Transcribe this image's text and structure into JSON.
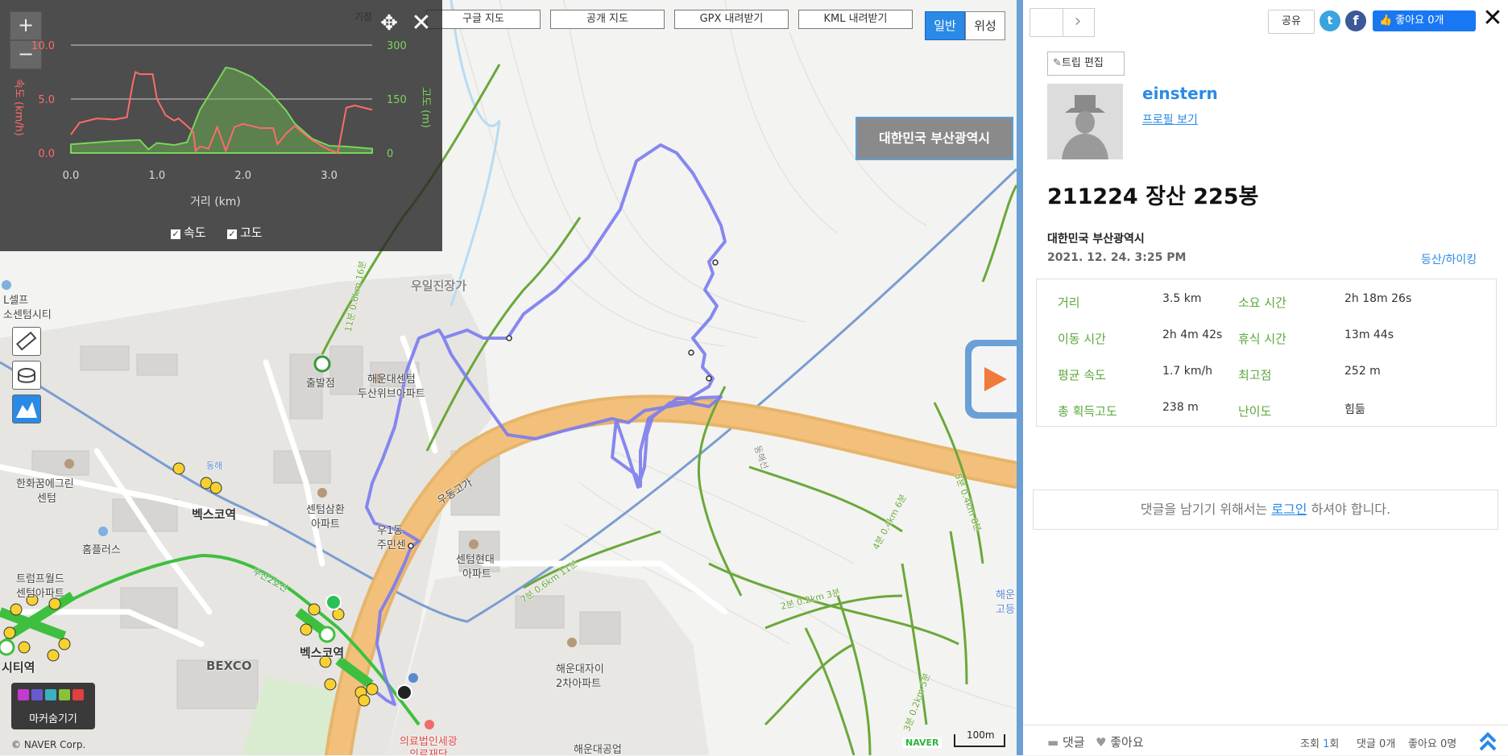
{
  "map": {
    "tools": {
      "google": "구글 지도",
      "open": "공개 지도",
      "gpx": "GPX 내려받기",
      "kml": "KML 내려받기"
    },
    "map_type": {
      "normal": "일반",
      "satellite": "위성"
    },
    "region_badge": "대한민국 부산광역시",
    "labels": {
      "self_center": "L셀프",
      "self_center2": "소센텀시티",
      "hanwha": "한화꿈에그린",
      "hanwha2": "센텀",
      "bexco_station": "벡스코역",
      "bexco_station2": "벡스코역",
      "homeplus": "홈플러스",
      "trump": "트럼프월드",
      "trump2": "센텀아파트",
      "bexco": "BEXCO",
      "city_station": "시티역",
      "samhwan": "센텀삼환",
      "samhwan2": "아파트",
      "haeundae_center": "해운대센텀",
      "haeundae_center2": "두산위브아파트",
      "start": "출발점",
      "udong": "우동고가",
      "community": "우1동",
      "community2": "주민센",
      "hyundai": "센텀현대",
      "hyundai2": "아파트",
      "haeundae_zai": "해운대자이",
      "haeundae_zai2": "2차아파트",
      "hospital": "의료법인세광",
      "hospital2": "의료재단",
      "school": "해운대공업",
      "ujin": "우일진장가",
      "haeun_right": "해운",
      "haeun_right2": "고등",
      "busan2": "부산2호선",
      "donghae": "동해",
      "donghae_line": "동해선",
      "trail1": "11분 0.6km 16분",
      "trail2": "7분 0.6km 11분",
      "trail3": "2분 0.2km 3분",
      "trail4": "4분 0.4km 6분",
      "trail5": "3분 0.2km 5분",
      "trail6": "5분 0.4km 8분",
      "giljeom": "기점"
    },
    "copyright": "© NAVER Corp.",
    "naver": "NAVER",
    "scale": "100m",
    "marker_hide_label": "마커숨기기",
    "elev_chart": {
      "x_label": "거리 (km)",
      "y_left_label": "속도 (km/h)",
      "y_right_label": "고도 (m)",
      "checkbox_speed": "속도",
      "checkbox_alt": "고도",
      "x_ticks": [
        "0.0",
        "1.0",
        "2.0",
        "3.0"
      ],
      "y_left_ticks": [
        "10.0",
        "5.0",
        "0.0"
      ],
      "y_right_ticks": [
        "300",
        "150",
        "0"
      ]
    }
  },
  "chart_data": {
    "type": "line",
    "x_label": "거리 (km)",
    "y_left_label": "속도 (km/h)",
    "y_right_label": "고도 (m)",
    "x_range": [
      0,
      3.5
    ],
    "y_left_range": [
      0,
      10
    ],
    "y_right_range": [
      0,
      300
    ],
    "series": [
      {
        "name": "속도",
        "color": "#ff6b6b",
        "axis": "left",
        "x": [
          0,
          0.1,
          0.3,
          0.5,
          0.65,
          0.72,
          0.75,
          0.8,
          0.95,
          1.0,
          1.1,
          1.2,
          1.25,
          1.35,
          1.42,
          1.45,
          1.5,
          1.6,
          1.7,
          1.8,
          1.9,
          2.0,
          2.2,
          2.35,
          2.4,
          2.5,
          2.6,
          2.8,
          2.95,
          3.0,
          3.1,
          3.2,
          3.3,
          3.5
        ],
        "y": [
          1.7,
          2.8,
          3.2,
          3.1,
          3.3,
          6.5,
          7.5,
          7.3,
          7.3,
          5.0,
          3.5,
          3.0,
          3.2,
          2.5,
          2.0,
          0.2,
          0.6,
          0.4,
          2.4,
          0.2,
          2.4,
          2.7,
          2.3,
          2.3,
          0.8,
          1.8,
          2.5,
          1.2,
          0.5,
          0.3,
          0.0,
          4.2,
          4.4,
          4.0
        ]
      },
      {
        "name": "고도",
        "color": "#7ad65a",
        "axis": "right",
        "x": [
          0,
          0.5,
          0.8,
          0.9,
          1.0,
          1.2,
          1.35,
          1.5,
          1.7,
          1.8,
          1.9,
          2.1,
          2.3,
          2.5,
          2.6,
          2.8,
          3.0,
          3.2,
          3.5
        ],
        "y": [
          24,
          33,
          36,
          10,
          28,
          22,
          30,
          120,
          198,
          238,
          233,
          212,
          172,
          118,
          82,
          40,
          20,
          18,
          12
        ]
      }
    ]
  },
  "panel": {
    "share": "공유",
    "like_button": "좋아요 0개",
    "edit_trip": "트립 편집",
    "username": "einstern",
    "profile_link": "프로필 보기",
    "trip_title": "211224 장산 225봉",
    "location": "대한민국 부산광역시",
    "date": "2021. 12. 24. 3:25 PM",
    "category": "등산/하이킹",
    "stats": [
      {
        "label": "거리",
        "value": "3.5 km"
      },
      {
        "label": "소요 시간",
        "value": "2h 18m 26s"
      },
      {
        "label": "이동 시간",
        "value": "2h 4m 42s"
      },
      {
        "label": "휴식 시간",
        "value": "13m 44s"
      },
      {
        "label": "평균 속도",
        "value": "1.7 km/h"
      },
      {
        "label": "최고점",
        "value": "252 m"
      },
      {
        "label": "총 획득고도",
        "value": "238 m"
      },
      {
        "label": "난이도",
        "value": "힘듦"
      }
    ],
    "comment_prompt_before": "댓글을 남기기 위해서는 ",
    "comment_login": "로그인",
    "comment_prompt_after": " 하셔야 합니다.",
    "footer": {
      "comment": "댓글",
      "like": "좋아요",
      "views_label": "조회",
      "views_count": "1",
      "views_unit": "회",
      "comments_count": "댓글 0개",
      "likes_count": "좋아요 0명"
    }
  }
}
